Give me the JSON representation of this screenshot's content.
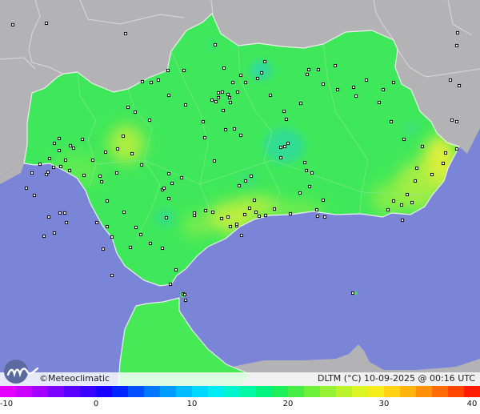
{
  "brand": {
    "symbol": "©",
    "name": "Meteoclimatic",
    "logo_icon": "meteoclimatic-logo-icon"
  },
  "info": {
    "variable": "DLTM",
    "unit": "(°C)",
    "date": "10-09-2025",
    "at": "@",
    "time": "00:16",
    "timezone": "UTC"
  },
  "colors": {
    "land_neutral": "#b3b3b6",
    "sea": "#7b85d8",
    "region_base": "#3fe85a",
    "borders": "#d9d9d9",
    "coast_line": "#eeeeee"
  },
  "scale": {
    "min": -10,
    "max": 40,
    "tick_labels": [
      "-10",
      "0",
      "10",
      "20",
      "30",
      "40"
    ],
    "colors": [
      "#e500ff",
      "#c900ff",
      "#a400ff",
      "#7d00ff",
      "#5a00ff",
      "#3a00ff",
      "#1800ff",
      "#0024ff",
      "#0050ff",
      "#0077ff",
      "#009cff",
      "#00bdff",
      "#00d8ff",
      "#00ecf2",
      "#00f5cf",
      "#00f7a6",
      "#00f37f",
      "#1bef5c",
      "#46ed44",
      "#6df03a",
      "#96f233",
      "#bbf32c",
      "#dcf324",
      "#f5ec1b",
      "#ffd313",
      "#ffb30d",
      "#ff9108",
      "#ff6c04",
      "#ff4501",
      "#ff1c00"
    ]
  },
  "stations": [
    [
      58,
      29
    ],
    [
      16,
      31
    ],
    [
      157,
      42
    ],
    [
      211,
      119
    ],
    [
      232,
      131
    ],
    [
      198,
      100
    ],
    [
      189,
      103
    ],
    [
      269,
      56
    ],
    [
      280,
      85
    ],
    [
      301,
      94
    ],
    [
      307,
      103
    ],
    [
      327,
      91
    ],
    [
      322,
      98
    ],
    [
      331,
      77
    ],
    [
      338,
      119
    ],
    [
      358,
      149
    ],
    [
      355,
      139
    ],
    [
      376,
      129
    ],
    [
      384,
      93
    ],
    [
      386,
      87
    ],
    [
      398,
      87
    ],
    [
      404,
      105
    ],
    [
      419,
      82
    ],
    [
      422,
      112
    ],
    [
      442,
      109
    ],
    [
      445,
      120
    ],
    [
      458,
      100
    ],
    [
      474,
      128
    ],
    [
      479,
      112
    ],
    [
      489,
      152
    ],
    [
      492,
      103
    ],
    [
      505,
      174
    ],
    [
      528,
      183
    ],
    [
      563,
      100
    ],
    [
      574,
      107
    ],
    [
      572,
      41
    ],
    [
      571,
      57
    ],
    [
      571,
      186
    ],
    [
      571,
      152
    ],
    [
      565,
      150
    ],
    [
      254,
      152
    ],
    [
      256,
      172
    ],
    [
      273,
      116
    ],
    [
      273,
      122
    ],
    [
      265,
      125
    ],
    [
      270,
      127
    ],
    [
      278,
      115
    ],
    [
      285,
      118
    ],
    [
      288,
      128
    ],
    [
      291,
      103
    ],
    [
      279,
      138
    ],
    [
      282,
      162
    ],
    [
      293,
      161
    ],
    [
      301,
      169
    ],
    [
      287,
      122
    ],
    [
      297,
      115
    ],
    [
      230,
      88
    ],
    [
      210,
      88
    ],
    [
      178,
      102
    ],
    [
      160,
      134
    ],
    [
      169,
      140
    ],
    [
      187,
      150
    ],
    [
      154,
      170
    ],
    [
      132,
      190
    ],
    [
      147,
      186
    ],
    [
      165,
      192
    ],
    [
      177,
      206
    ],
    [
      146,
      216
    ],
    [
      125,
      220
    ],
    [
      105,
      219
    ],
    [
      87,
      213
    ],
    [
      76,
      208
    ],
    [
      82,
      200
    ],
    [
      92,
      185
    ],
    [
      103,
      174
    ],
    [
      88,
      182
    ],
    [
      74,
      188
    ],
    [
      74,
      173
    ],
    [
      68,
      179
    ],
    [
      62,
      198
    ],
    [
      60,
      215
    ],
    [
      67,
      209
    ],
    [
      58,
      218
    ],
    [
      50,
      205
    ],
    [
      40,
      216
    ],
    [
      33,
      235
    ],
    [
      43,
      244
    ],
    [
      61,
      271
    ],
    [
      75,
      266
    ],
    [
      81,
      266
    ],
    [
      55,
      295
    ],
    [
      68,
      291
    ],
    [
      83,
      278
    ],
    [
      116,
      200
    ],
    [
      127,
      227
    ],
    [
      134,
      251
    ],
    [
      121,
      278
    ],
    [
      134,
      283
    ],
    [
      140,
      296
    ],
    [
      129,
      311
    ],
    [
      140,
      344
    ],
    [
      163,
      309
    ],
    [
      188,
      304
    ],
    [
      203,
      310
    ],
    [
      220,
      337
    ],
    [
      213,
      355
    ],
    [
      155,
      265
    ],
    [
      176,
      293
    ],
    [
      170,
      284
    ],
    [
      203,
      237
    ],
    [
      211,
      248
    ],
    [
      208,
      272
    ],
    [
      243,
      269
    ],
    [
      243,
      266
    ],
    [
      257,
      263
    ],
    [
      266,
      265
    ],
    [
      277,
      273
    ],
    [
      285,
      271
    ],
    [
      288,
      283
    ],
    [
      296,
      282
    ],
    [
      302,
      294
    ],
    [
      296,
      280
    ],
    [
      306,
      268
    ],
    [
      312,
      260
    ],
    [
      320,
      265
    ],
    [
      318,
      250
    ],
    [
      324,
      270
    ],
    [
      332,
      269
    ],
    [
      343,
      261
    ],
    [
      363,
      267
    ],
    [
      375,
      241
    ],
    [
      383,
      213
    ],
    [
      381,
      203
    ],
    [
      390,
      216
    ],
    [
      387,
      233
    ],
    [
      396,
      262
    ],
    [
      404,
      250
    ],
    [
      406,
      271
    ],
    [
      397,
      270
    ],
    [
      360,
      179
    ],
    [
      351,
      184
    ],
    [
      356,
      183
    ],
    [
      351,
      197
    ],
    [
      314,
      220
    ],
    [
      307,
      226
    ],
    [
      299,
      232
    ],
    [
      268,
      201
    ],
    [
      227,
      222
    ],
    [
      211,
      217
    ],
    [
      205,
      235
    ],
    [
      215,
      229
    ],
    [
      485,
      262
    ],
    [
      492,
      251
    ],
    [
      502,
      256
    ],
    [
      515,
      253
    ],
    [
      509,
      243
    ],
    [
      519,
      226
    ],
    [
      503,
      275
    ],
    [
      521,
      210
    ],
    [
      540,
      218
    ],
    [
      557,
      191
    ],
    [
      554,
      204
    ],
    [
      441,
      366
    ],
    [
      229,
      367
    ],
    [
      232,
      375
    ],
    [
      231,
      368
    ]
  ]
}
